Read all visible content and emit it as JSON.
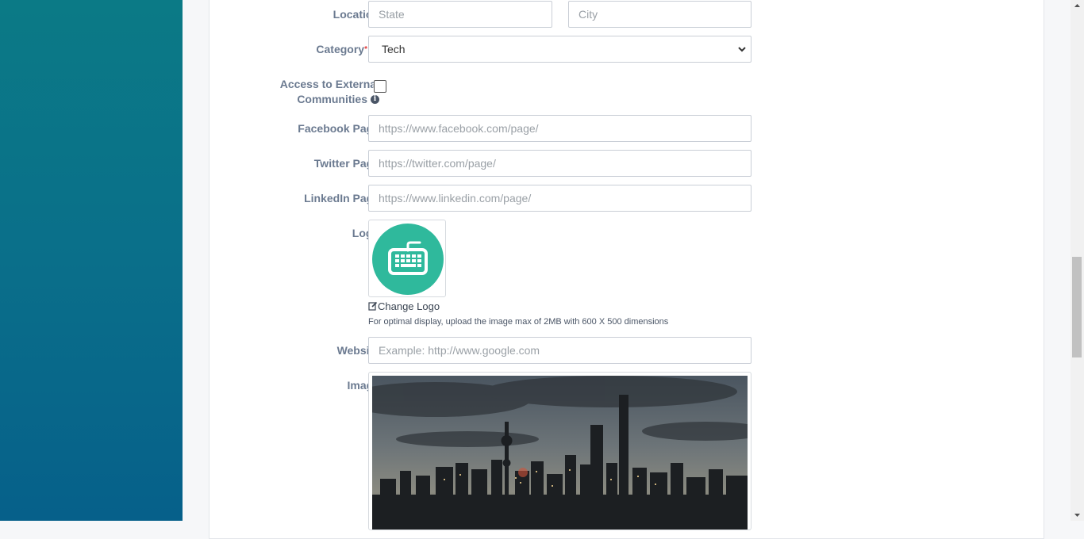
{
  "form": {
    "location": {
      "label": "Location",
      "state_placeholder": "State",
      "city_placeholder": "City"
    },
    "category": {
      "label": "Category",
      "required_mark": "*",
      "selected": "Tech"
    },
    "external_access": {
      "label_line1": "Access to External",
      "label_line2": "Communities",
      "checked": false
    },
    "facebook": {
      "label": "Facebook Page",
      "placeholder": "https://www.facebook.com/page/"
    },
    "twitter": {
      "label": "Twitter Page",
      "placeholder": "https://twitter.com/page/"
    },
    "linkedin": {
      "label": "LinkedIn Page",
      "placeholder": "https://www.linkedin.com/page/"
    },
    "logo": {
      "label": "Logo",
      "change_label": "Change Logo",
      "help_text": "For optimal display, upload the image max of 2MB with 600 X 500 dimensions"
    },
    "website": {
      "label": "Website",
      "placeholder": "Example: http://www.google.com"
    },
    "image": {
      "label": "Image"
    }
  },
  "colors": {
    "sidebar_top": "#0b7a86",
    "sidebar_bottom": "#06608a",
    "logo_accent": "#2fb99c",
    "label": "#6b7a90",
    "required": "#e23b3b"
  }
}
